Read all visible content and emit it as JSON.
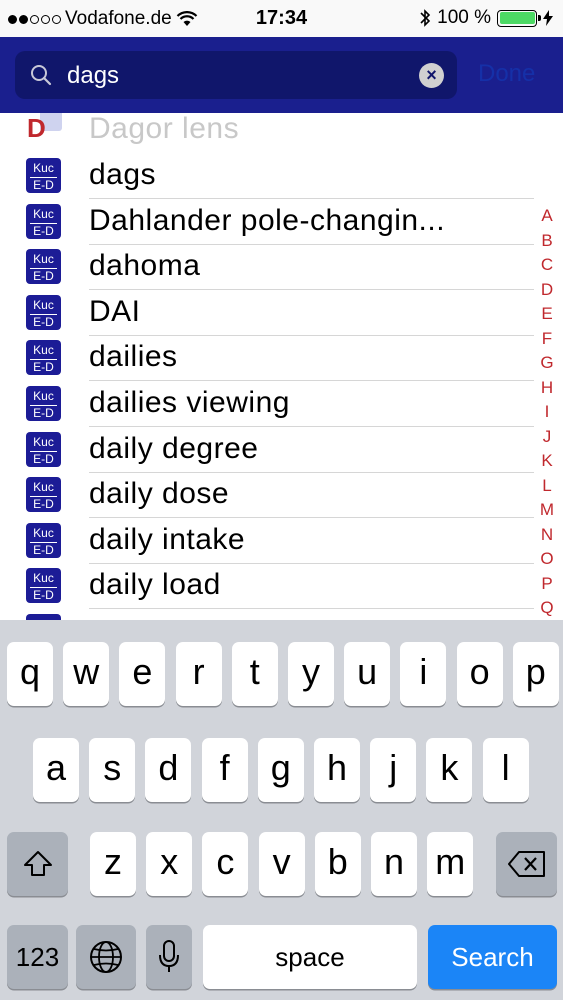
{
  "status": {
    "carrier": "Vodafone.de",
    "time": "17:34",
    "battery_pct": "100 %"
  },
  "search": {
    "query": "dags",
    "done_label": "Done"
  },
  "list": {
    "section_letter": "D",
    "partial_item": "Dagor lens",
    "icon_top": "Kuc",
    "icon_bottom": "E-D",
    "items": [
      "dags",
      "Dahlander pole-changin...",
      "dahoma",
      "DAI",
      "dailies",
      "dailies viewing",
      "daily degree",
      "daily dose",
      "daily intake",
      "daily load"
    ]
  },
  "index": [
    "A",
    "B",
    "C",
    "D",
    "E",
    "F",
    "G",
    "H",
    "I",
    "J",
    "K",
    "L",
    "M",
    "N",
    "O",
    "P",
    "Q"
  ],
  "keyboard": {
    "row1": [
      "q",
      "w",
      "e",
      "r",
      "t",
      "y",
      "u",
      "i",
      "o",
      "p"
    ],
    "row2": [
      "a",
      "s",
      "d",
      "f",
      "g",
      "h",
      "j",
      "k",
      "l"
    ],
    "row3": [
      "z",
      "x",
      "c",
      "v",
      "b",
      "n",
      "m"
    ],
    "numbers": "123",
    "space": "space",
    "search": "Search"
  },
  "colors": {
    "header": "#1a1f8e",
    "accent_red": "#c0282d",
    "search_key": "#1b85f7"
  }
}
